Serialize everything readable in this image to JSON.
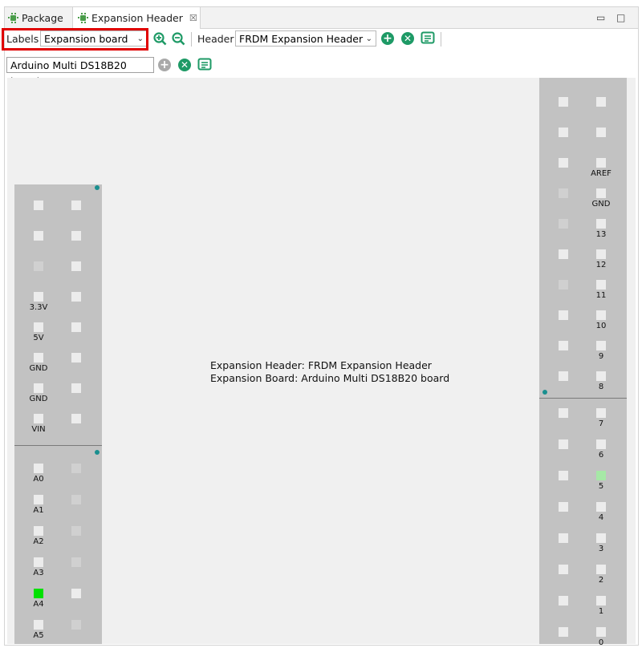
{
  "tabs": [
    {
      "label": "Package",
      "active": false
    },
    {
      "label": "Expansion Header",
      "active": true
    }
  ],
  "window_controls": {
    "close_tab": "☒",
    "minimize": "▭",
    "maximize": "□"
  },
  "toolbar": {
    "labels_label": "Labels",
    "labels_value": "Expansion board",
    "header_label": "Header",
    "header_value": "FRDM Expansion Header",
    "board_value": "Arduino Multi DS18B20 board",
    "icons": [
      "zoom-in-icon",
      "zoom-out-icon",
      "add-icon",
      "remove-icon",
      "list-icon"
    ],
    "accent": "#1e9a66",
    "highlight_outline": "#e00000"
  },
  "info": {
    "line1": "Expansion Header: FRDM Expansion Header",
    "line2": "Expansion Board: Arduino Multi DS18B20 board"
  },
  "left_header": {
    "top_block": [
      {
        "label": "",
        "c1": "n",
        "c2": "n"
      },
      {
        "label": "",
        "c1": "n",
        "c2": "n"
      },
      {
        "label": "",
        "c1": "d",
        "c2": "n"
      },
      {
        "label": "3.3V",
        "c1": "n",
        "c2": "n"
      },
      {
        "label": "5V",
        "c1": "n",
        "c2": "n"
      },
      {
        "label": "GND",
        "c1": "n",
        "c2": "n"
      },
      {
        "label": "GND",
        "c1": "n",
        "c2": "n"
      },
      {
        "label": "VIN",
        "c1": "n",
        "c2": "n"
      }
    ],
    "bottom_block": [
      {
        "label": "A0",
        "c1": "n",
        "c2": "d"
      },
      {
        "label": "A1",
        "c1": "n",
        "c2": "d"
      },
      {
        "label": "A2",
        "c1": "n",
        "c2": "d"
      },
      {
        "label": "A3",
        "c1": "n",
        "c2": "d"
      },
      {
        "label": "A4",
        "c1": "bright",
        "c2": "n"
      },
      {
        "label": "A5",
        "c1": "n",
        "c2": "d"
      }
    ]
  },
  "right_header": {
    "top_block": [
      {
        "label": "",
        "c1": "n",
        "c2": "n"
      },
      {
        "label": "",
        "c1": "n",
        "c2": "n"
      },
      {
        "label": "AREF",
        "c1": "n",
        "c2": "n"
      },
      {
        "label": "GND",
        "c1": "d",
        "c2": "n"
      },
      {
        "label": "13",
        "c1": "d",
        "c2": "n"
      },
      {
        "label": "12",
        "c1": "n",
        "c2": "n"
      },
      {
        "label": "11",
        "c1": "d",
        "c2": "n"
      },
      {
        "label": "10",
        "c1": "n",
        "c2": "n"
      },
      {
        "label": "9",
        "c1": "n",
        "c2": "n"
      },
      {
        "label": "8",
        "c1": "n",
        "c2": "n"
      }
    ],
    "bottom_block": [
      {
        "label": "7",
        "c1": "n",
        "c2": "n"
      },
      {
        "label": "6",
        "c1": "n",
        "c2": "n"
      },
      {
        "label": "5",
        "c1": "n",
        "c2": "light"
      },
      {
        "label": "4",
        "c1": "n",
        "c2": "n"
      },
      {
        "label": "3",
        "c1": "n",
        "c2": "n"
      },
      {
        "label": "2",
        "c1": "n",
        "c2": "n"
      },
      {
        "label": "1",
        "c1": "n",
        "c2": "n"
      },
      {
        "label": "0",
        "c1": "n",
        "c2": "n"
      }
    ]
  }
}
